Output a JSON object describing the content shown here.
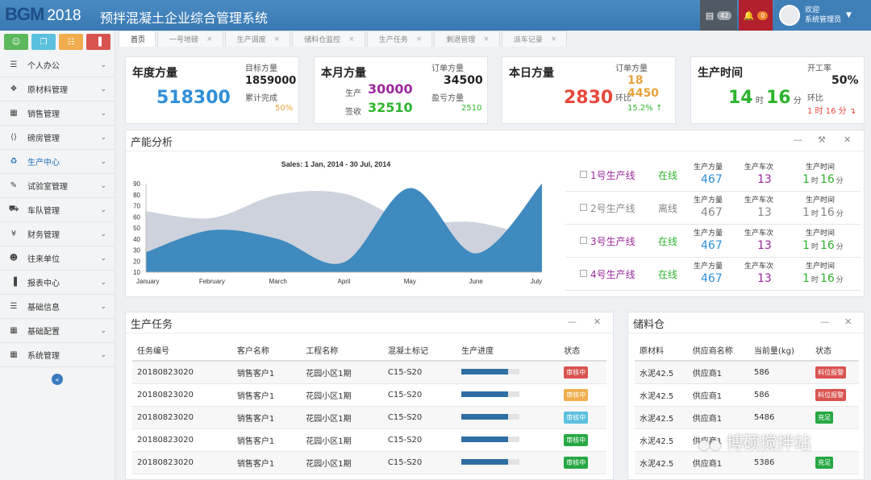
{
  "header": {
    "logo": "BGM",
    "year": "2018",
    "title": "预拌混凝土企业综合管理系统",
    "mail_count": "42",
    "bell_count": "0",
    "welcome": "欢迎",
    "user": "系统管理员"
  },
  "sidebar": {
    "top_icons": [
      {
        "icon": "users-icon",
        "color": "#5cb85c"
      },
      {
        "icon": "copy-icon",
        "color": "#5bc0de"
      },
      {
        "icon": "file-icon",
        "color": "#f0ad4e"
      },
      {
        "icon": "bar-chart-icon",
        "color": "#d9534f"
      }
    ],
    "items": [
      {
        "label": "个人办公",
        "icon": "list-icon"
      },
      {
        "label": "原材料管理",
        "icon": "cubes-icon"
      },
      {
        "label": "销售管理",
        "icon": "grid-icon"
      },
      {
        "label": "磅房管理",
        "icon": "code-icon"
      },
      {
        "label": "生产中心",
        "icon": "recycle-icon"
      },
      {
        "label": "试验室管理",
        "icon": "eyedropper-icon"
      },
      {
        "label": "车队管理",
        "icon": "truck-icon"
      },
      {
        "label": "财务管理",
        "icon": "yen-icon"
      },
      {
        "label": "往来单位",
        "icon": "user-icon"
      },
      {
        "label": "报表中心",
        "icon": "bar-chart-icon"
      },
      {
        "label": "基础信息",
        "icon": "list-icon"
      },
      {
        "label": "基础配置",
        "icon": "grid-icon"
      },
      {
        "label": "系统管理",
        "icon": "grid-icon"
      }
    ]
  },
  "tabs": [
    "首页",
    "一号地磅",
    "生产调度",
    "储料仓监控",
    "生产任务",
    "剩退管理",
    "派车记录"
  ],
  "cards": {
    "annual": {
      "title": "年度方量",
      "value": "518300",
      "target_label": "目标方量",
      "target": "1859000",
      "done_label": "累计完成",
      "done": "50%"
    },
    "monthly": {
      "title": "本月方量",
      "prod_label": "生产",
      "prod": "30000",
      "sign_label": "签收",
      "sign": "32510",
      "order_label": "订单方量",
      "order": "34500",
      "pl_label": "盈亏方量",
      "pl": "2510"
    },
    "daily": {
      "title": "本日方量",
      "value": "2830",
      "order_label": "订单方量",
      "order": "18 4450",
      "ratio_label": "环比",
      "ratio": "15.2%"
    },
    "time": {
      "title": "生产时间",
      "hours": "14",
      "h_unit": "时",
      "minutes": "16",
      "m_unit": "分",
      "rate_label": "开工率",
      "rate": "50%",
      "ratio_label": "环比",
      "ratio": "1 时 16 分"
    }
  },
  "capacity": {
    "title": "产能分析"
  },
  "chart_data": {
    "type": "area",
    "title": "Sales: 1 Jan, 2014 - 30 Jul, 2014",
    "categories": [
      "January",
      "February",
      "March",
      "April",
      "May",
      "June",
      "July"
    ],
    "ylim": [
      10,
      90
    ],
    "yticks": [
      10,
      20,
      30,
      40,
      50,
      60,
      70,
      80,
      90
    ],
    "series": [
      {
        "values": [
          65,
          59,
          80,
          81,
          56,
          55,
          40
        ],
        "color": "#c8cdd8"
      },
      {
        "values": [
          28,
          48,
          40,
          19,
          86,
          27,
          90
        ],
        "color": "#3f8abf"
      }
    ]
  },
  "lines": {
    "head_amount": "生产方量",
    "head_trips": "生产车次",
    "head_time": "生产时间",
    "h_unit": "时",
    "m_unit": "分",
    "rows": [
      {
        "name": "1号生产线",
        "status": "在线",
        "amount": "467",
        "trips": "13",
        "hours": "1",
        "minutes": "16",
        "online": true
      },
      {
        "name": "2号生产线",
        "status": "离线",
        "amount": "467",
        "trips": "13",
        "hours": "1",
        "minutes": "16",
        "online": false
      },
      {
        "name": "3号生产线",
        "status": "在线",
        "amount": "467",
        "trips": "13",
        "hours": "1",
        "minutes": "16",
        "online": true
      },
      {
        "name": "4号生产线",
        "status": "在线",
        "amount": "467",
        "trips": "13",
        "hours": "1",
        "minutes": "16",
        "online": true
      }
    ]
  },
  "tasks": {
    "title": "生产任务",
    "columns": [
      "任务编号",
      "客户名称",
      "工程名称",
      "混凝土标记",
      "生产进度",
      "状态"
    ],
    "rows": [
      {
        "id": "20180823020",
        "client": "销售客户1",
        "project": "花园小区1期",
        "grade": "C15-S20",
        "progress": 0.8,
        "status": "审核中",
        "color": "#d9534f"
      },
      {
        "id": "20180823020",
        "client": "销售客户1",
        "project": "花园小区1期",
        "grade": "C15-S20",
        "progress": 0.8,
        "status": "审核中",
        "color": "#f0ad4e"
      },
      {
        "id": "20180823020",
        "client": "销售客户1",
        "project": "花园小区1期",
        "grade": "C15-S20",
        "progress": 0.8,
        "status": "审核中",
        "color": "#5bc0de"
      },
      {
        "id": "20180823020",
        "client": "销售客户1",
        "project": "花园小区1期",
        "grade": "C15-S20",
        "progress": 0.8,
        "status": "审核中",
        "color": "#27a844"
      },
      {
        "id": "20180823020",
        "client": "销售客户1",
        "project": "花园小区1期",
        "grade": "C15-S20",
        "progress": 0.8,
        "status": "审核中",
        "color": "#27a844"
      }
    ]
  },
  "silo": {
    "title": "储料仓",
    "columns": [
      "原材料",
      "供应商名称",
      "当前量(kg)",
      "状态"
    ],
    "rows": [
      {
        "material": "水泥42.5",
        "supplier": "供应商1",
        "amount": "586",
        "status": "料位报警",
        "color": "#d9534f"
      },
      {
        "material": "水泥42.5",
        "supplier": "供应商1",
        "amount": "586",
        "status": "料位报警",
        "color": "#d9534f"
      },
      {
        "material": "水泥42.5",
        "supplier": "供应商1",
        "amount": "5486",
        "status": "充足",
        "color": "#27a844"
      },
      {
        "material": "水泥42.5",
        "supplier": "供应商1",
        "amount": "",
        "status": "",
        "color": ""
      },
      {
        "material": "水泥42.5",
        "supplier": "供应商1",
        "amount": "5386",
        "status": "充足",
        "color": "#27a844"
      }
    ]
  },
  "watermark": "博硕搅拌站",
  "colors": {
    "blue": "#2f8fd8",
    "purple": "#9b2a9b",
    "green": "#2db52d",
    "red": "#e8483c",
    "orange": "#e8a33a",
    "gray": "#888888"
  }
}
